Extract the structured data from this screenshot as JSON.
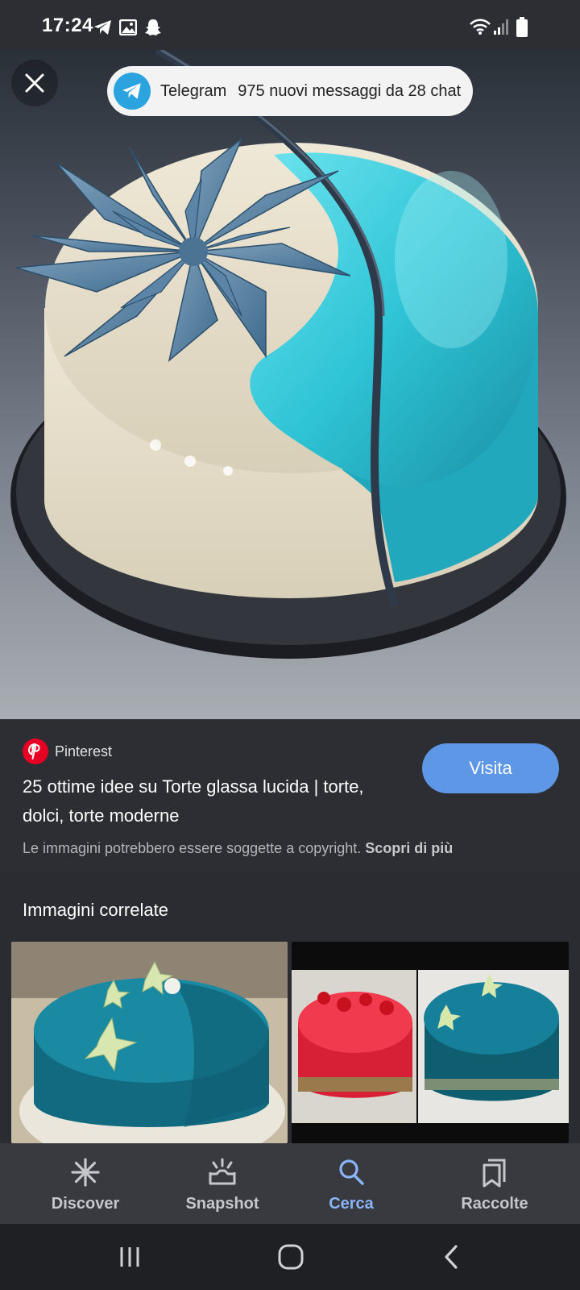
{
  "status_bar": {
    "time": "17:24",
    "left_icons": [
      "telegram-icon",
      "gallery-icon",
      "snapchat-icon"
    ],
    "right_icons": [
      "wifi-icon",
      "signal-icon",
      "battery-icon"
    ]
  },
  "notification": {
    "app": "Telegram",
    "message": "975 nuovi messaggi da 28 chat"
  },
  "result": {
    "source": "Pinterest",
    "title": "25 ottime idee su Torte glassa lucida | torte, dolci, torte moderne",
    "visit_label": "Visita",
    "copyright_text": "Le immagini potrebbero essere soggette a copyright.",
    "learn_more": "Scopri di più"
  },
  "related": {
    "heading": "Immagini correlate"
  },
  "bottom_nav": [
    {
      "label": "Discover",
      "icon": "asterisk-icon"
    },
    {
      "label": "Snapshot",
      "icon": "snapshot-icon"
    },
    {
      "label": "Cerca",
      "icon": "search-icon"
    },
    {
      "label": "Raccolte",
      "icon": "collections-icon"
    }
  ],
  "colors": {
    "accent": "#5e97e6",
    "active_nav": "#8ab4f8",
    "pinterest": "#e60023",
    "telegram": "#2aa3df",
    "glaze": "#2ec4d6"
  }
}
